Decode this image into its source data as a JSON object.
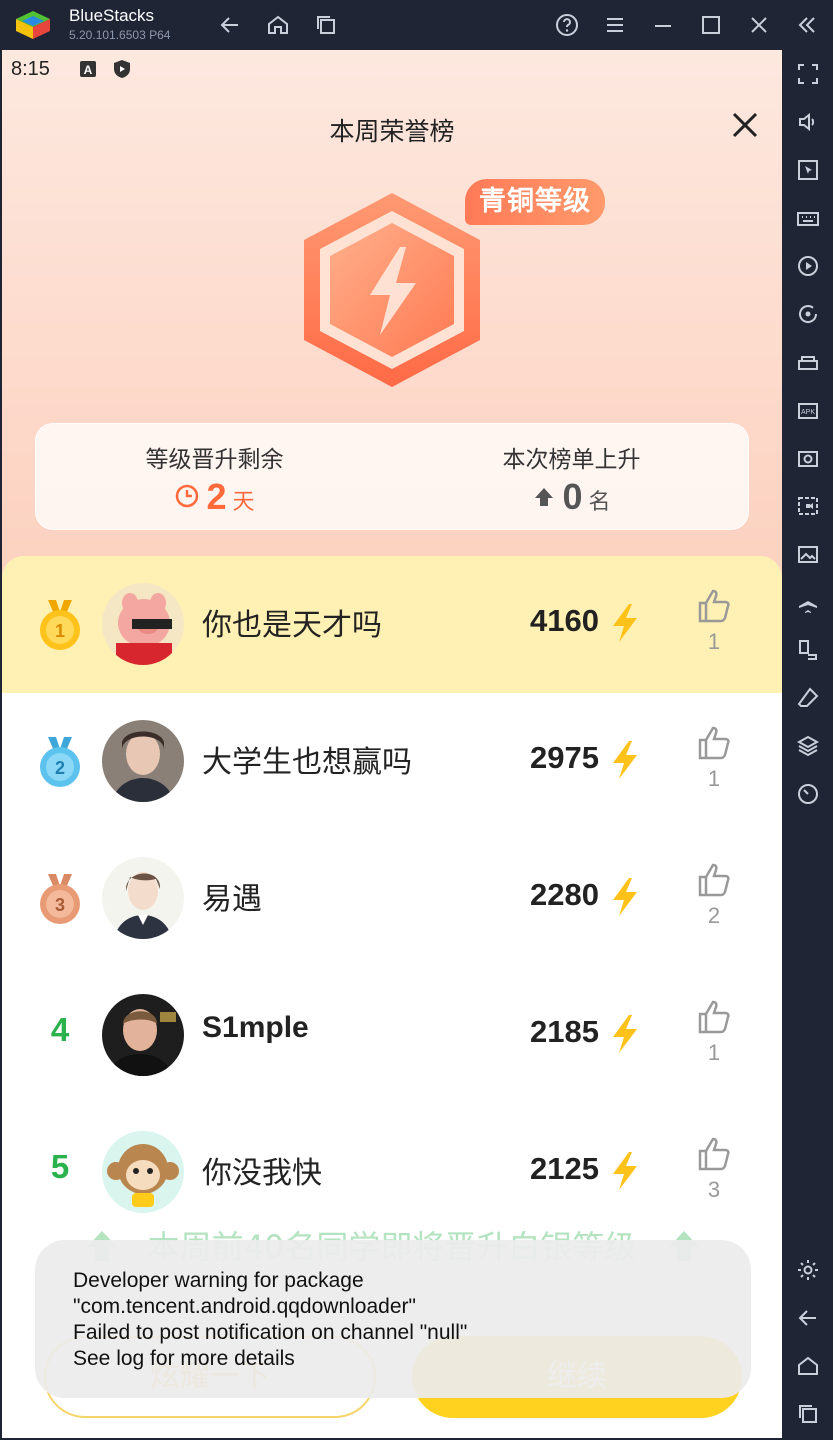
{
  "window": {
    "app_name": "BlueStacks",
    "version": "5.20.101.6503  P64"
  },
  "status_bar": {
    "time": "8:15"
  },
  "page": {
    "title": "本周荣誉榜",
    "level_badge": "青铜等级"
  },
  "stats": {
    "left": {
      "label": "等级晋升剩余",
      "value": "2",
      "unit": "天",
      "color": "#ff6a3d"
    },
    "right": {
      "label": "本次榜单上升",
      "value": "0",
      "unit": "名",
      "color": "#555555"
    }
  },
  "ranking": [
    {
      "rank": "1",
      "name": "你也是天才吗",
      "score": "4160",
      "likes": "1"
    },
    {
      "rank": "2",
      "name": "大学生也想赢吗",
      "score": "2975",
      "likes": "1"
    },
    {
      "rank": "3",
      "name": "易遇",
      "score": "2280",
      "likes": "2"
    },
    {
      "rank": "4",
      "name": "S1mple",
      "score": "2185",
      "likes": "1"
    },
    {
      "rank": "5",
      "name": "你没我快",
      "score": "2125",
      "likes": "3"
    }
  ],
  "promo": "本周前40名同学即将晋升白银等级",
  "buttons": {
    "share": "炫耀一下",
    "continue": "继续"
  },
  "toast": {
    "line1": "Developer warning for package",
    "line2": "\"com.tencent.android.qqdownloader\"",
    "line3": "Failed to post notification on channel \"null\"",
    "line4": "See log for more details"
  },
  "colors": {
    "accent": "#ff7a57",
    "rank_green": "#2bb24c",
    "highlight_row": "#fff0b3",
    "bolt": "#ffc21a"
  }
}
